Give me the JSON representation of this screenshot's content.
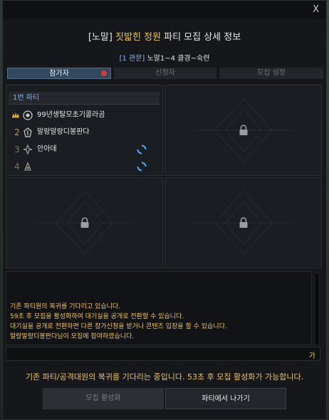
{
  "window": {
    "close_label": "X",
    "title_prefix": "[노말]",
    "title_name": "짓밟힌 정원",
    "title_suffix": "파티 모집 상세 정보",
    "subtitle_tag": "[1 관문]",
    "subtitle_text": "노말1~4 클경~숙련"
  },
  "tabs": [
    {
      "label": "참가자",
      "active": true
    },
    {
      "label": "신청자",
      "active": false
    },
    {
      "label": "모집 설정",
      "active": false
    }
  ],
  "party": {
    "header": "1번 파티",
    "members": [
      {
        "number": "",
        "name": "99년생탈모초기콜라곰",
        "icon": "crown-icon",
        "status": "ready"
      },
      {
        "number": "2",
        "name": "말랑말랑디봉판다",
        "icon": "class-emblem-icon",
        "status": "ready"
      },
      {
        "number": "3",
        "name": "안아데",
        "icon": "class-emblem-icon",
        "status": "waiting"
      },
      {
        "number": "4",
        "name": "",
        "icon": "class-emblem-icon",
        "status": "waiting"
      }
    ]
  },
  "chat": {
    "lines": [
      "기존 파티원의 복귀를 기다리고 있습니다.",
      "59초 후 모집을 활성화하여 대기실을 공개로 전환할 수 있습니다.",
      "대기실을 공개로 전환하면 다른 참가신청을 받거나 콘텐츠 입장을 할 수 있습니다.",
      "말랑말랑디봉판다님이 모집에 참여하였습니다."
    ],
    "input_lang": "가"
  },
  "notice": "기존 파티/공격대원의 복귀를 기다리는 중입니다. 53초 후 모집 활성화가 가능합니다.",
  "buttons": {
    "activate": "모집 활성화",
    "leave": "파티에서 나가기"
  },
  "colors": {
    "gold": "#e8c35a",
    "blue_link": "#8cb4ff",
    "tab_active": "#33495f",
    "badge_red": "#d83a3a"
  }
}
